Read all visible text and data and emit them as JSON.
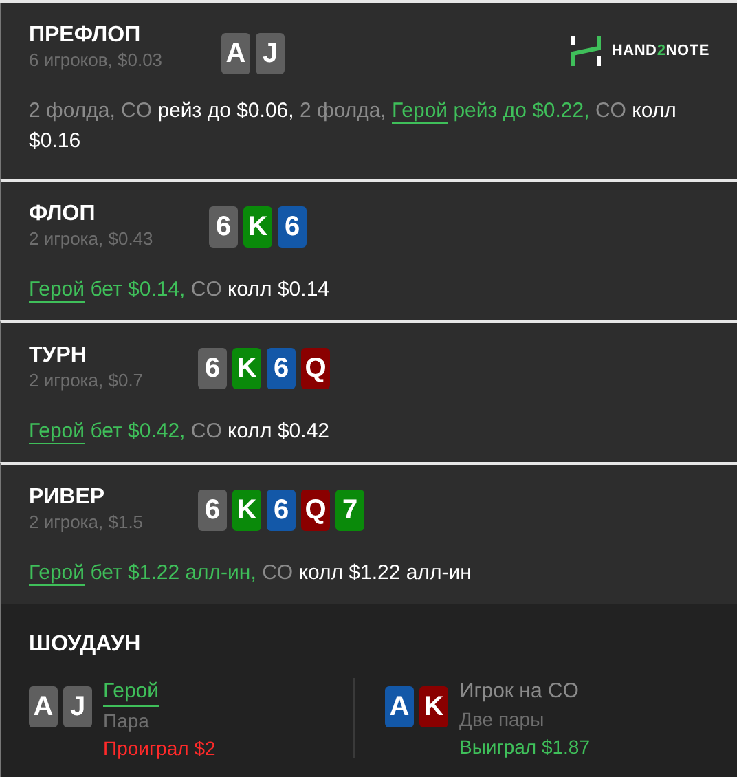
{
  "logo": {
    "parts": [
      {
        "text": "HAND",
        "accent": false
      },
      {
        "text": "2",
        "accent": true
      },
      {
        "text": "NOTE",
        "accent": false
      }
    ]
  },
  "streets": [
    {
      "name": "ПРЕФЛОП",
      "info": "6 игроков, $0.03",
      "cards": [
        {
          "rank": "A",
          "color": "#5f5f5f"
        },
        {
          "rank": "J",
          "color": "#5f5f5f"
        }
      ],
      "actions": [
        {
          "text": "2 фолда, ",
          "kind": "muted"
        },
        {
          "text": "CO ",
          "kind": "muted"
        },
        {
          "text": "рейз до $0.06, ",
          "kind": "strong"
        },
        {
          "text": "2 фолда, ",
          "kind": "muted"
        },
        {
          "text": "Герой",
          "kind": "hero_link"
        },
        {
          "text": " рейз до $0.22, ",
          "kind": "hero"
        },
        {
          "text": "CO ",
          "kind": "muted"
        },
        {
          "text": "колл $0.16",
          "kind": "strong"
        }
      ]
    },
    {
      "name": "ФЛОП",
      "info": "2 игрока, $0.43",
      "cards": [
        {
          "rank": "6",
          "color": "#5f5f5f"
        },
        {
          "rank": "K",
          "color": "#0a8a0a"
        },
        {
          "rank": "6",
          "color": "#1358a8"
        }
      ],
      "actions": [
        {
          "text": "Герой",
          "kind": "hero_link"
        },
        {
          "text": " бет $0.14, ",
          "kind": "hero"
        },
        {
          "text": "CO ",
          "kind": "muted"
        },
        {
          "text": "колл $0.14",
          "kind": "strong"
        }
      ]
    },
    {
      "name": "ТУРН",
      "info": "2 игрока, $0.7",
      "cards": [
        {
          "rank": "6",
          "color": "#5f5f5f"
        },
        {
          "rank": "K",
          "color": "#0a8a0a"
        },
        {
          "rank": "6",
          "color": "#1358a8"
        },
        {
          "rank": "Q",
          "color": "#8a0000"
        }
      ],
      "actions": [
        {
          "text": "Герой",
          "kind": "hero_link"
        },
        {
          "text": " бет $0.42, ",
          "kind": "hero"
        },
        {
          "text": "CO ",
          "kind": "muted"
        },
        {
          "text": "колл $0.42",
          "kind": "strong"
        }
      ]
    },
    {
      "name": "РИВЕР",
      "info": "2 игрока, $1.5",
      "cards": [
        {
          "rank": "6",
          "color": "#5f5f5f"
        },
        {
          "rank": "K",
          "color": "#0a8a0a"
        },
        {
          "rank": "6",
          "color": "#1358a8"
        },
        {
          "rank": "Q",
          "color": "#8a0000"
        },
        {
          "rank": "7",
          "color": "#0a8a0a"
        }
      ],
      "actions": [
        {
          "text": "Герой",
          "kind": "hero_link"
        },
        {
          "text": " бет $1.22 алл-ин, ",
          "kind": "hero"
        },
        {
          "text": "CO ",
          "kind": "muted"
        },
        {
          "text": "колл $1.22 алл-ин",
          "kind": "strong"
        }
      ]
    }
  ],
  "showdown": {
    "title": "ШОУДАУН",
    "players": [
      {
        "name": "Герой",
        "hero": true,
        "hand": "Пара",
        "result": "Проиграл $2",
        "won": false,
        "cards": [
          {
            "rank": "A",
            "color": "#5f5f5f"
          },
          {
            "rank": "J",
            "color": "#5f5f5f"
          }
        ]
      },
      {
        "name": "Игрок на CO",
        "hero": false,
        "hand": "Две пары",
        "result": "Выиграл $1.87",
        "won": true,
        "cards": [
          {
            "rank": "A",
            "color": "#1358a8"
          },
          {
            "rank": "K",
            "color": "#8a0000"
          }
        ]
      }
    ]
  }
}
